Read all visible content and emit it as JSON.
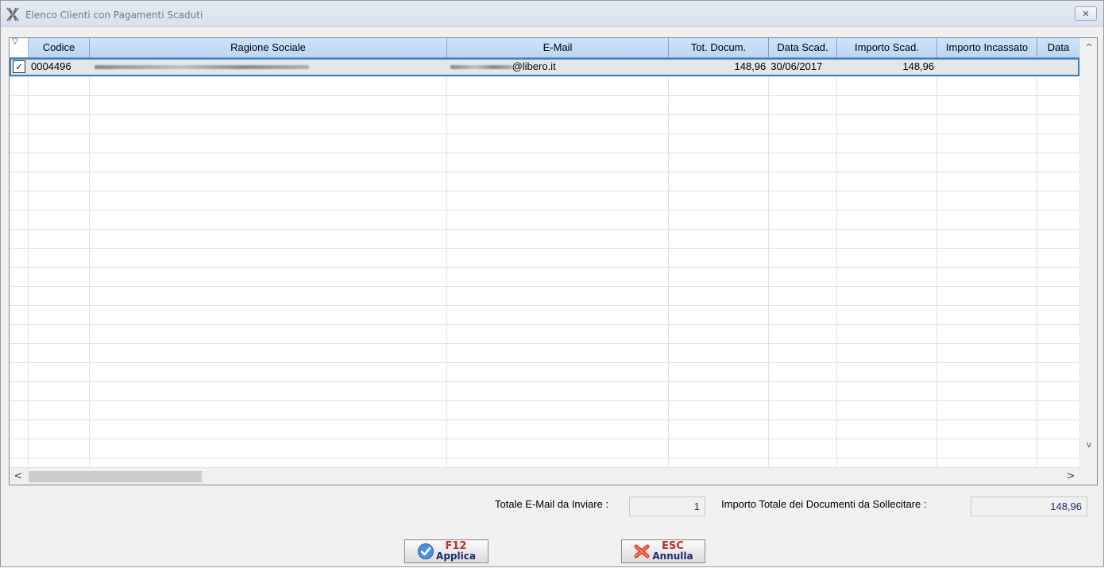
{
  "window": {
    "title": "Elenco Clienti con Pagamenti Scaduti",
    "close_glyph": "✕"
  },
  "grid": {
    "select_glyph": "▽",
    "columns": [
      {
        "key": "sel",
        "label": ""
      },
      {
        "key": "codice",
        "label": "Codice"
      },
      {
        "key": "ragione",
        "label": "Ragione Sociale"
      },
      {
        "key": "email",
        "label": "E-Mail"
      },
      {
        "key": "tot",
        "label": "Tot. Docum."
      },
      {
        "key": "data_scad",
        "label": "Data Scad."
      },
      {
        "key": "imp_scad",
        "label": "Importo Scad."
      },
      {
        "key": "imp_inc",
        "label": "Importo Incassato"
      },
      {
        "key": "data",
        "label": "Data"
      }
    ],
    "rows": [
      {
        "checked": true,
        "codice": "0004496",
        "ragione": "",
        "email": "@libero.it",
        "tot": "148,96",
        "data_scad": "30/06/2017",
        "imp_scad": "148,96",
        "imp_inc": "",
        "data": ""
      }
    ]
  },
  "scroll": {
    "up": "^",
    "down": "v",
    "left": "<",
    "right": ">"
  },
  "totals": {
    "email_label": "Totale E-Mail da Inviare :",
    "email_value": "1",
    "amount_label": "Importo Totale dei Documenti da Sollecitare :",
    "amount_value": "148,96"
  },
  "buttons": {
    "apply_key": "F12",
    "apply_label": "Applica",
    "cancel_key": "ESC",
    "cancel_label": "Annulla"
  }
}
